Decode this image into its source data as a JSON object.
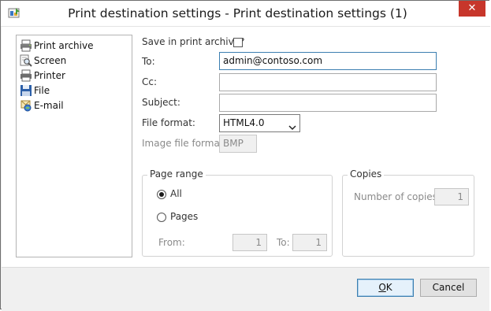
{
  "window": {
    "title": "Print destination settings - Print destination settings (1)",
    "close_glyph": "✕"
  },
  "destinations": [
    {
      "label": "Print archive",
      "icon": "print-archive-icon"
    },
    {
      "label": "Screen",
      "icon": "screen-preview-icon"
    },
    {
      "label": "Printer",
      "icon": "printer-icon"
    },
    {
      "label": "File",
      "icon": "floppy-disk-icon"
    },
    {
      "label": "E-mail",
      "icon": "email-icon"
    }
  ],
  "selected_destination": "E-mail",
  "form": {
    "save_archive_label": "Save in print archive?",
    "save_archive_checked": false,
    "to_label": "To:",
    "to_value": "admin@contoso.com",
    "cc_label": "Cc:",
    "cc_value": "",
    "subject_label": "Subject:",
    "subject_value": "",
    "file_format_label": "File format:",
    "file_format_value": "HTML4.0",
    "image_format_label": "Image file format:",
    "image_format_value": "BMP"
  },
  "page_range": {
    "title": "Page range",
    "all_label": "All",
    "pages_label": "Pages",
    "from_label": "From:",
    "from_value": "1",
    "to_label": "To:",
    "to_value": "1",
    "selected": "All"
  },
  "copies": {
    "title": "Copies",
    "number_label": "Number of copies:",
    "number_value": "1"
  },
  "buttons": {
    "ok_access_key": "O",
    "ok_rest": "K",
    "cancel_label": "Cancel"
  },
  "colors": {
    "close_button": "#c7362b",
    "default_button_border": "#3c7fb1",
    "focus_border": "#3c7fb1"
  }
}
